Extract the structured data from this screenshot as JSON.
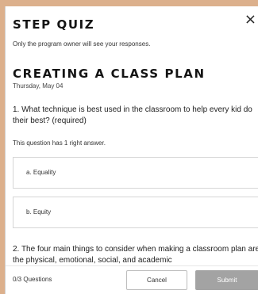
{
  "modal": {
    "title": "STEP QUIZ",
    "privacy_note": "Only the program owner will see your responses.",
    "close_icon": "×"
  },
  "plan": {
    "title": "CREATING A CLASS PLAN",
    "date": "Thursday, May 04"
  },
  "questions": [
    {
      "text": "1. What technique is best used in the classroom to help every kid do their best? (required)",
      "note": "This question has 1 right answer.",
      "options": [
        "a. Equality",
        "b. Equity"
      ]
    },
    {
      "text": "2. The four main things to consider when making a classroom plan are the physical, emotional, social, and academic"
    }
  ],
  "footer": {
    "progress": "0/3 Questions",
    "cancel_label": "Cancel",
    "submit_label": "Submit"
  }
}
